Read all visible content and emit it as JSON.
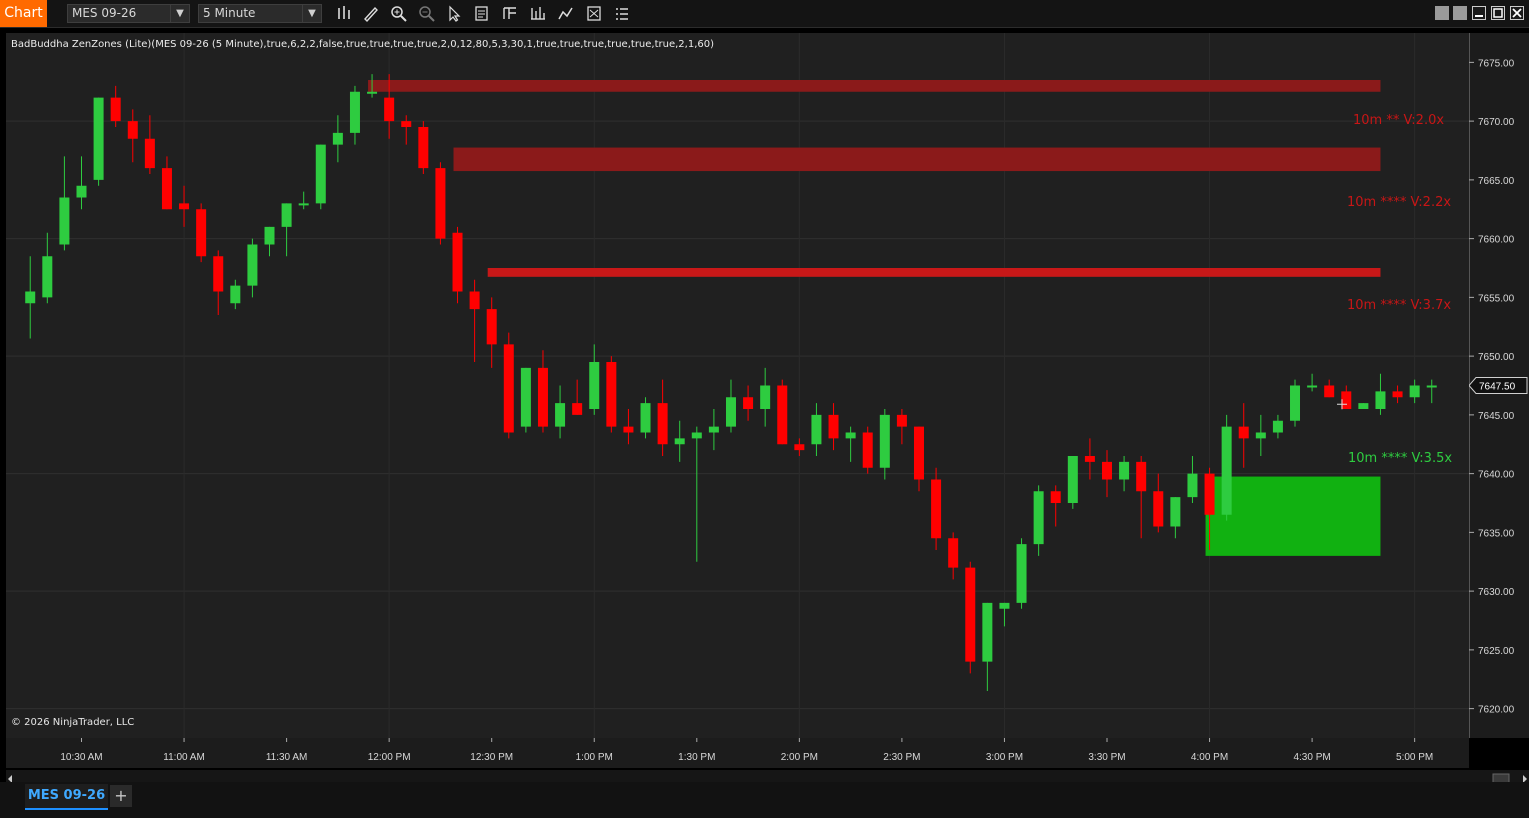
{
  "toolbar": {
    "chart_label": "Chart",
    "instrument": "MES 09-26",
    "interval": "5 Minute",
    "tools": [
      "bar-type-icon",
      "draw-pencil-icon",
      "zoom-in-icon",
      "zoom-out-icon",
      "pointer-icon",
      "properties-icon",
      "template-icon",
      "indicators-icon",
      "strategies-icon",
      "data-box-icon",
      "menu-icon"
    ],
    "window_buttons": [
      "tile-icon",
      "tile-icon",
      "minimize-icon",
      "maximize-icon",
      "close-icon"
    ]
  },
  "indicator_label": "BadBuddha ZenZones (Lite)(MES 09-26 (5 Minute),true,6,2,2,false,true,true,true,true,2,0,12,80,5,3,30,1,true,true,true,true,true,true,2,1,60)",
  "copyright": "© 2026 NinjaTrader, LLC",
  "colors": {
    "up": "#2ecc40",
    "down": "#ff0000",
    "background": "#202020",
    "supply": "#8b1a1a",
    "demand": "#11b111",
    "accent": "#ff6a00"
  },
  "zone_labels": [
    {
      "text": "10m ** V:2.0x",
      "color": "#c81616"
    },
    {
      "text": "10m **** V:2.2x",
      "color": "#c81616"
    },
    {
      "text": "10m **** V:3.7x",
      "color": "#c81616"
    },
    {
      "text": "10m **** V:3.5x",
      "color": "#2ecc40"
    }
  ],
  "chart_data": {
    "type": "candlestick",
    "interval": "5 Minute",
    "instrument": "MES 09-26",
    "ylim": [
      7617.5,
      7677.5
    ],
    "y_ticks": [
      "7675.00",
      "7670.00",
      "7665.00",
      "7660.00",
      "7655.00",
      "7650.00",
      "7645.00",
      "7640.00",
      "7635.00",
      "7630.00",
      "7625.00",
      "7620.00"
    ],
    "y_tick_values": [
      7675,
      7670,
      7665,
      7660,
      7655,
      7650,
      7645,
      7640,
      7635,
      7630,
      7625,
      7620
    ],
    "x_ticks": [
      "10:30 AM",
      "11:00 AM",
      "11:30 AM",
      "12:00 PM",
      "12:30 PM",
      "1:00 PM",
      "1:30 PM",
      "2:00 PM",
      "2:30 PM",
      "3:00 PM",
      "3:30 PM",
      "4:00 PM",
      "4:30 PM",
      "5:00 PM"
    ],
    "x_tick_minutes": [
      630,
      660,
      690,
      720,
      750,
      780,
      810,
      840,
      870,
      900,
      930,
      960,
      990,
      1020
    ],
    "last_price": "7647.50",
    "last_price_value": 7647.5,
    "candles": [
      {
        "t": "10:15",
        "o": 7654.5,
        "h": 7658.5,
        "l": 7651.5,
        "c": 7655.5
      },
      {
        "t": "10:20",
        "o": 7655.0,
        "h": 7660.5,
        "l": 7654.5,
        "c": 7658.5
      },
      {
        "t": "10:25",
        "o": 7659.5,
        "h": 7667.0,
        "l": 7659.0,
        "c": 7663.5
      },
      {
        "t": "10:30",
        "o": 7663.5,
        "h": 7667.0,
        "l": 7662.5,
        "c": 7664.5
      },
      {
        "t": "10:35",
        "o": 7665.0,
        "h": 7672.0,
        "l": 7664.5,
        "c": 7672.0
      },
      {
        "t": "10:40",
        "o": 7672.0,
        "h": 7673.0,
        "l": 7669.5,
        "c": 7670.0
      },
      {
        "t": "10:45",
        "o": 7670.0,
        "h": 7671.0,
        "l": 7666.5,
        "c": 7668.5
      },
      {
        "t": "10:50",
        "o": 7668.5,
        "h": 7670.5,
        "l": 7665.5,
        "c": 7666.0
      },
      {
        "t": "10:55",
        "o": 7666.0,
        "h": 7667.0,
        "l": 7662.5,
        "c": 7662.5
      },
      {
        "t": "11:00",
        "o": 7663.0,
        "h": 7664.5,
        "l": 7661.0,
        "c": 7662.5
      },
      {
        "t": "11:05",
        "o": 7662.5,
        "h": 7663.0,
        "l": 7658.0,
        "c": 7658.5
      },
      {
        "t": "11:10",
        "o": 7658.5,
        "h": 7659.0,
        "l": 7653.5,
        "c": 7655.5
      },
      {
        "t": "11:15",
        "o": 7654.5,
        "h": 7656.5,
        "l": 7654.0,
        "c": 7656.0
      },
      {
        "t": "11:20",
        "o": 7656.0,
        "h": 7660.0,
        "l": 7655.0,
        "c": 7659.5
      },
      {
        "t": "11:25",
        "o": 7659.5,
        "h": 7661.0,
        "l": 7658.5,
        "c": 7661.0
      },
      {
        "t": "11:30",
        "o": 7661.0,
        "h": 7663.0,
        "l": 7658.5,
        "c": 7663.0
      },
      {
        "t": "11:35",
        "o": 7663.0,
        "h": 7664.0,
        "l": 7662.5,
        "c": 7663.0
      },
      {
        "t": "11:40",
        "o": 7663.0,
        "h": 7668.0,
        "l": 7662.5,
        "c": 7668.0
      },
      {
        "t": "11:45",
        "o": 7668.0,
        "h": 7670.5,
        "l": 7666.5,
        "c": 7669.0
      },
      {
        "t": "11:50",
        "o": 7669.0,
        "h": 7673.0,
        "l": 7668.0,
        "c": 7672.5
      },
      {
        "t": "11:55",
        "o": 7672.5,
        "h": 7674.0,
        "l": 7672.0,
        "c": 7672.5
      },
      {
        "t": "12:00",
        "o": 7672.0,
        "h": 7674.0,
        "l": 7668.5,
        "c": 7670.0
      },
      {
        "t": "12:05",
        "o": 7670.0,
        "h": 7670.5,
        "l": 7668.0,
        "c": 7669.5
      },
      {
        "t": "12:10",
        "o": 7669.5,
        "h": 7670.0,
        "l": 7665.5,
        "c": 7666.0
      },
      {
        "t": "12:15",
        "o": 7666.0,
        "h": 7666.5,
        "l": 7659.5,
        "c": 7660.0
      },
      {
        "t": "12:20",
        "o": 7660.5,
        "h": 7661.0,
        "l": 7654.5,
        "c": 7655.5
      },
      {
        "t": "12:25",
        "o": 7655.5,
        "h": 7656.5,
        "l": 7649.5,
        "c": 7654.0
      },
      {
        "t": "12:30",
        "o": 7654.0,
        "h": 7655.0,
        "l": 7649.0,
        "c": 7651.0
      },
      {
        "t": "12:35",
        "o": 7651.0,
        "h": 7652.0,
        "l": 7643.0,
        "c": 7643.5
      },
      {
        "t": "12:40",
        "o": 7644.0,
        "h": 7649.0,
        "l": 7643.5,
        "c": 7649.0
      },
      {
        "t": "12:45",
        "o": 7649.0,
        "h": 7650.5,
        "l": 7643.5,
        "c": 7644.0
      },
      {
        "t": "12:50",
        "o": 7644.0,
        "h": 7647.5,
        "l": 7643.0,
        "c": 7646.0
      },
      {
        "t": "12:55",
        "o": 7646.0,
        "h": 7648.0,
        "l": 7645.0,
        "c": 7645.0
      },
      {
        "t": "13:00",
        "o": 7645.5,
        "h": 7651.0,
        "l": 7645.0,
        "c": 7649.5
      },
      {
        "t": "13:05",
        "o": 7649.5,
        "h": 7650.0,
        "l": 7643.5,
        "c": 7644.0
      },
      {
        "t": "13:10",
        "o": 7644.0,
        "h": 7645.5,
        "l": 7642.5,
        "c": 7643.5
      },
      {
        "t": "13:15",
        "o": 7643.5,
        "h": 7646.5,
        "l": 7643.0,
        "c": 7646.0
      },
      {
        "t": "13:20",
        "o": 7646.0,
        "h": 7648.0,
        "l": 7641.5,
        "c": 7642.5
      },
      {
        "t": "13:25",
        "o": 7642.5,
        "h": 7644.5,
        "l": 7641.0,
        "c": 7643.0
      },
      {
        "t": "13:30",
        "o": 7643.0,
        "h": 7644.0,
        "l": 7632.5,
        "c": 7643.5
      },
      {
        "t": "13:35",
        "o": 7643.5,
        "h": 7645.5,
        "l": 7642.0,
        "c": 7644.0
      },
      {
        "t": "13:40",
        "o": 7644.0,
        "h": 7648.0,
        "l": 7643.5,
        "c": 7646.5
      },
      {
        "t": "13:45",
        "o": 7646.5,
        "h": 7647.5,
        "l": 7644.5,
        "c": 7645.5
      },
      {
        "t": "13:50",
        "o": 7645.5,
        "h": 7649.0,
        "l": 7644.0,
        "c": 7647.5
      },
      {
        "t": "13:55",
        "o": 7647.5,
        "h": 7648.0,
        "l": 7642.5,
        "c": 7642.5
      },
      {
        "t": "14:00",
        "o": 7642.5,
        "h": 7643.0,
        "l": 7641.5,
        "c": 7642.0
      },
      {
        "t": "14:05",
        "o": 7642.5,
        "h": 7646.0,
        "l": 7641.5,
        "c": 7645.0
      },
      {
        "t": "14:10",
        "o": 7645.0,
        "h": 7646.0,
        "l": 7642.0,
        "c": 7643.0
      },
      {
        "t": "14:15",
        "o": 7643.0,
        "h": 7644.0,
        "l": 7641.0,
        "c": 7643.5
      },
      {
        "t": "14:20",
        "o": 7643.5,
        "h": 7644.0,
        "l": 7640.0,
        "c": 7640.5
      },
      {
        "t": "14:25",
        "o": 7640.5,
        "h": 7645.5,
        "l": 7639.5,
        "c": 7645.0
      },
      {
        "t": "14:30",
        "o": 7645.0,
        "h": 7645.5,
        "l": 7642.5,
        "c": 7644.0
      },
      {
        "t": "14:35",
        "o": 7644.0,
        "h": 7644.0,
        "l": 7638.5,
        "c": 7639.5
      },
      {
        "t": "14:40",
        "o": 7639.5,
        "h": 7640.5,
        "l": 7633.5,
        "c": 7634.5
      },
      {
        "t": "14:45",
        "o": 7634.5,
        "h": 7635.0,
        "l": 7631.0,
        "c": 7632.0
      },
      {
        "t": "14:50",
        "o": 7632.0,
        "h": 7632.5,
        "l": 7623.0,
        "c": 7624.0
      },
      {
        "t": "14:55",
        "o": 7624.0,
        "h": 7629.0,
        "l": 7621.5,
        "c": 7629.0
      },
      {
        "t": "15:00",
        "o": 7628.5,
        "h": 7629.0,
        "l": 7627.0,
        "c": 7629.0
      },
      {
        "t": "15:05",
        "o": 7629.0,
        "h": 7634.5,
        "l": 7628.5,
        "c": 7634.0
      },
      {
        "t": "15:10",
        "o": 7634.0,
        "h": 7639.0,
        "l": 7633.0,
        "c": 7638.5
      },
      {
        "t": "15:15",
        "o": 7638.5,
        "h": 7639.0,
        "l": 7635.5,
        "c": 7637.5
      },
      {
        "t": "15:20",
        "o": 7637.5,
        "h": 7641.5,
        "l": 7637.0,
        "c": 7641.5
      },
      {
        "t": "15:25",
        "o": 7641.5,
        "h": 7643.0,
        "l": 7639.5,
        "c": 7641.0
      },
      {
        "t": "15:30",
        "o": 7641.0,
        "h": 7642.0,
        "l": 7638.0,
        "c": 7639.5
      },
      {
        "t": "15:35",
        "o": 7639.5,
        "h": 7641.5,
        "l": 7638.5,
        "c": 7641.0
      },
      {
        "t": "15:40",
        "o": 7641.0,
        "h": 7641.5,
        "l": 7634.5,
        "c": 7638.5
      },
      {
        "t": "15:45",
        "o": 7638.5,
        "h": 7640.0,
        "l": 7635.0,
        "c": 7635.5
      },
      {
        "t": "15:50",
        "o": 7635.5,
        "h": 7638.0,
        "l": 7634.5,
        "c": 7638.0
      },
      {
        "t": "15:55",
        "o": 7638.0,
        "h": 7641.5,
        "l": 7637.5,
        "c": 7640.0
      },
      {
        "t": "16:00",
        "o": 7640.0,
        "h": 7640.5,
        "l": 7633.5,
        "c": 7636.5
      },
      {
        "t": "16:05",
        "o": 7636.5,
        "h": 7645.0,
        "l": 7636.0,
        "c": 7644.0
      },
      {
        "t": "16:10",
        "o": 7644.0,
        "h": 7646.0,
        "l": 7640.5,
        "c": 7643.0
      },
      {
        "t": "16:15",
        "o": 7643.0,
        "h": 7645.0,
        "l": 7641.5,
        "c": 7643.5
      },
      {
        "t": "16:20",
        "o": 7643.5,
        "h": 7645.0,
        "l": 7643.0,
        "c": 7644.5
      },
      {
        "t": "16:25",
        "o": 7644.5,
        "h": 7648.0,
        "l": 7644.0,
        "c": 7647.5
      },
      {
        "t": "16:30",
        "o": 7647.5,
        "h": 7648.5,
        "l": 7647.0,
        "c": 7647.5
      },
      {
        "t": "16:35",
        "o": 7647.5,
        "h": 7648.0,
        "l": 7646.5,
        "c": 7646.5
      },
      {
        "t": "16:40",
        "o": 7647.0,
        "h": 7647.5,
        "l": 7645.5,
        "c": 7645.5
      },
      {
        "t": "16:45",
        "o": 7645.5,
        "h": 7646.0,
        "l": 7645.5,
        "c": 7646.0
      },
      {
        "t": "16:50",
        "o": 7645.5,
        "h": 7648.5,
        "l": 7645.0,
        "c": 7647.0
      },
      {
        "t": "16:55",
        "o": 7647.0,
        "h": 7647.5,
        "l": 7646.0,
        "c": 7646.5
      },
      {
        "t": "17:00",
        "o": 7646.5,
        "h": 7648.0,
        "l": 7646.0,
        "c": 7647.5
      },
      {
        "t": "17:05",
        "o": 7647.5,
        "h": 7648.0,
        "l": 7646.0,
        "c": 7647.5
      }
    ],
    "zones": [
      {
        "kind": "supply",
        "start": "11:55",
        "top": 7673.5,
        "bottom": 7672.5,
        "label_index": 0
      },
      {
        "kind": "supply",
        "start": "12:20",
        "top": 7667.75,
        "bottom": 7665.75,
        "label_index": 1
      },
      {
        "kind": "supply",
        "start": "12:30",
        "top": 7657.5,
        "bottom": 7656.75,
        "label_index": 2
      },
      {
        "kind": "demand",
        "start": "16:00",
        "top": 7639.75,
        "bottom": 7633.0,
        "label_index": 3
      }
    ],
    "zone_end": "16:50",
    "title": "",
    "xlabel": "",
    "ylabel": ""
  },
  "bottom": {
    "tab": "MES 09-26",
    "add_tab": "+"
  }
}
